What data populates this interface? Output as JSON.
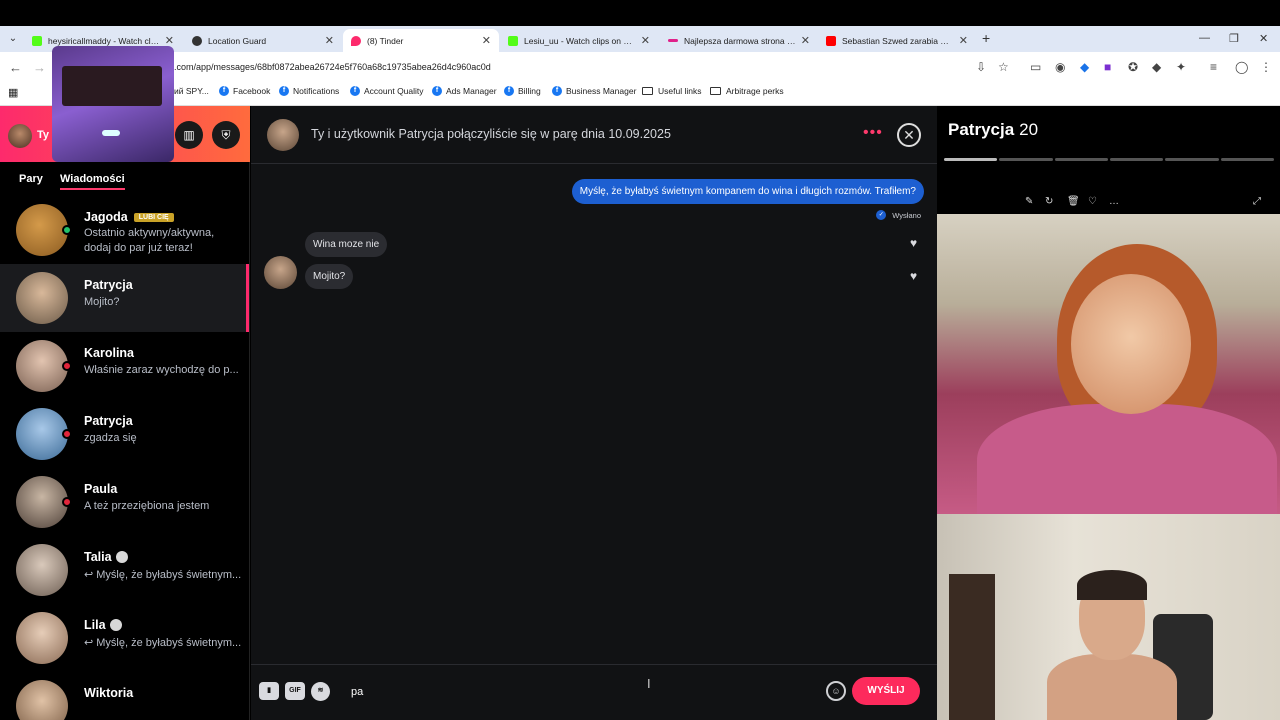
{
  "browser": {
    "tabs": [
      {
        "title": "heysiricallmaddy - Watch clips",
        "favicon_color": "#53fc18"
      },
      {
        "title": "Location Guard",
        "favicon_color": "#333333"
      },
      {
        "title": "(8) Tinder",
        "favicon_color": "#fd2a6c"
      },
      {
        "title": "Lesiu_uu - Watch clips on Kick",
        "favicon_color": "#53fc18"
      },
      {
        "title": "Najlepsza darmowa strona i apl",
        "favicon_color": "#e0218a"
      },
      {
        "title": "Sebastian Szwed zarabia milion",
        "favicon_color": "#ff0000"
      }
    ],
    "url": ".com/app/messages/68bf0872abea26724e5f760a68c19735abea26d4c960ac0d",
    "bookmarks": [
      {
        "label": "ий SPY..."
      },
      {
        "label": "Facebook"
      },
      {
        "label": "Notifications"
      },
      {
        "label": "Account Quality"
      },
      {
        "label": "Ads Manager"
      },
      {
        "label": "Billing"
      },
      {
        "label": "Business Manager"
      },
      {
        "label": "Useful links"
      },
      {
        "label": "Arbitrage perks"
      }
    ]
  },
  "sidebar": {
    "user_name": "Ty",
    "tabs": {
      "matches": "Pary",
      "messages": "Wiadomości"
    },
    "conversations": [
      {
        "name": "Jagoda",
        "badge": "LUBI CIĘ",
        "preview": "Ostatnio aktywny/aktywna, dodaj do par już teraz!",
        "dot_color": "#23c16b"
      },
      {
        "name": "Patrycja",
        "preview": "Mojito?"
      },
      {
        "name": "Karolina",
        "preview": "Właśnie zaraz wychodzę do p...",
        "dot_color": "#e0263b"
      },
      {
        "name": "Patrycja",
        "preview": "zgadza się",
        "dot_color": "#e0263b"
      },
      {
        "name": "Paula",
        "preview": "A też przeziębiona jestem",
        "dot_color": "#e0263b"
      },
      {
        "name": "Talia",
        "preview": "↩ Myślę, że byłabyś świetnym..."
      },
      {
        "name": "Lila",
        "preview": "↩ Myślę, że byłabyś świetnym..."
      },
      {
        "name": "Wiktoria",
        "preview": ""
      }
    ]
  },
  "chat": {
    "header": "Ty i użytkownik Patrycja połączyliście się w parę dnia 10.09.2025",
    "messages": {
      "outgoing": "Myślę, że byłabyś świetnym kompanem do wina i długich rozmów. Trafiłem?",
      "status": "Wysłano",
      "incoming1": "Wina moze nie",
      "incoming2": "Mojito?"
    },
    "composer": {
      "gif": "GIF",
      "text": "pa",
      "send": "WYŚLIJ"
    }
  },
  "profile": {
    "name": "Patrycja",
    "age": "20",
    "photo_count": 6,
    "current_photo": 1
  }
}
